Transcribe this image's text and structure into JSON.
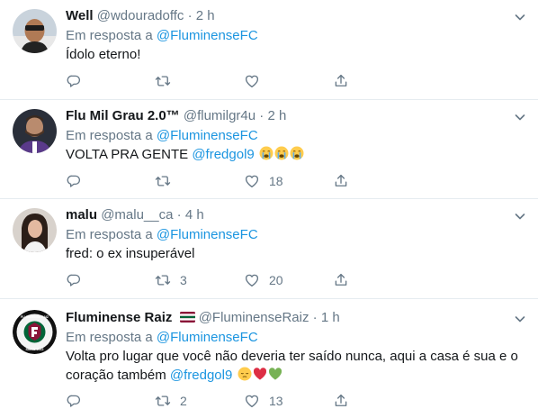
{
  "feed": {
    "tweets": [
      {
        "display_name": "Well",
        "handle": "@wdouradoffc",
        "dot": "·",
        "time": "2 h",
        "reply_prefix": "Em resposta a",
        "reply_to": "@FluminenseFC",
        "text": "Ídolo eterno!",
        "replies": "",
        "retweets": "",
        "likes": ""
      },
      {
        "display_name": "Flu Mil Grau 2.0™",
        "handle": "@flumilgr4u",
        "dot": "·",
        "time": "2 h",
        "reply_prefix": "Em resposta a",
        "reply_to": "@FluminenseFC",
        "text_before": "VOLTA PRA GENTE",
        "text_mention": "@fredgol9",
        "emojis": [
          "crying-face",
          "crying-face",
          "crying-face"
        ],
        "replies": "",
        "retweets": "",
        "likes": "18"
      },
      {
        "display_name": "malu",
        "handle": "@malu__ca",
        "dot": "·",
        "time": "4 h",
        "reply_prefix": "Em resposta a",
        "reply_to": "@FluminenseFC",
        "text": "fred: o ex insuperável",
        "replies": "",
        "retweets": "3",
        "likes": "20"
      },
      {
        "display_name": "Fluminense Raiz",
        "flag": "fluminense-flag",
        "handle": "@FluminenseRaiz",
        "dot": "·",
        "time": "1 h",
        "reply_prefix": "Em resposta a",
        "reply_to": "@FluminenseFC",
        "text_line1": "Volta pro lugar que você não deveria ter saído nunca, aqui a casa é sua e o",
        "text_line2": "coração também",
        "text_mention": "@fredgol9",
        "emojis": [
          "pensive-face",
          "red-heart",
          "green-heart"
        ],
        "avatar_text_top": "FLUMINENSE RAIZ",
        "avatar_text_bottom": "SINCE 2012",
        "replies": "",
        "retweets": "2",
        "likes": "13"
      }
    ]
  },
  "colors": {
    "link": "#1b95e0",
    "secondary_text": "#657786",
    "divider": "#e6ecf0",
    "fluminense_green": "#006437",
    "fluminense_red": "#8a1538"
  },
  "icons": [
    "chevron-down-icon",
    "reply-icon",
    "retweet-icon",
    "like-icon",
    "share-icon"
  ]
}
